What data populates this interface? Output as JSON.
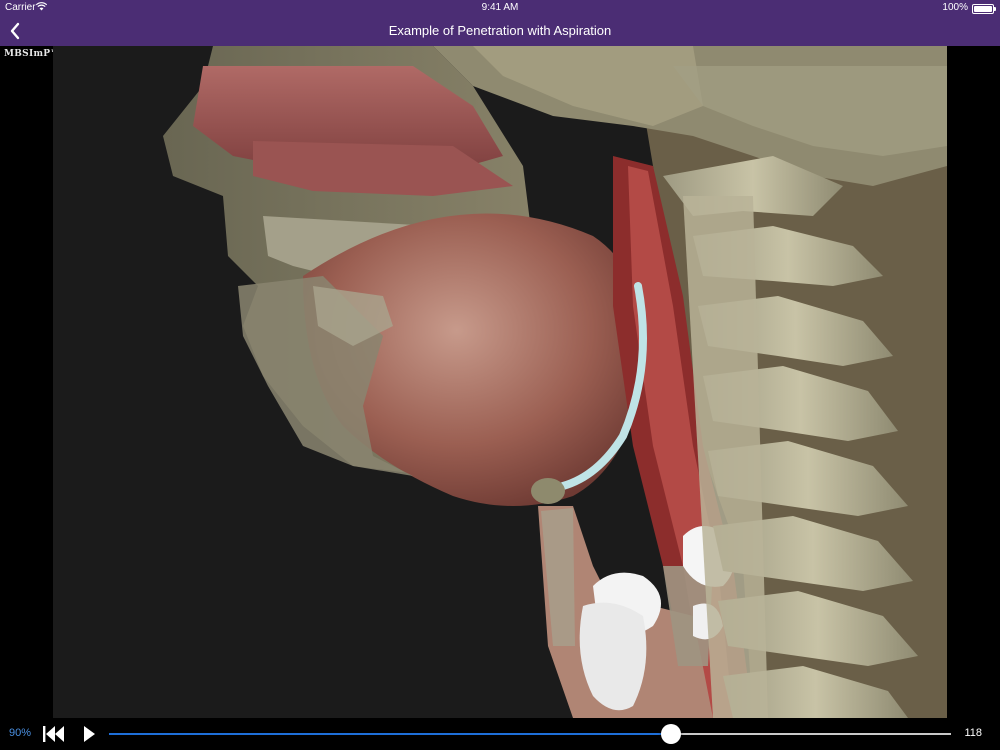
{
  "status_bar": {
    "carrier": "Carrier",
    "time": "9:41 AM",
    "battery": "100%"
  },
  "nav": {
    "title": "Example of Penetration with Aspiration",
    "back_icon": "chevron-left-icon"
  },
  "video": {
    "logo": "MBSImP™",
    "description_icons": [
      "skull",
      "vertebrae",
      "tongue",
      "larynx",
      "bolus"
    ]
  },
  "controls": {
    "speed": "90%",
    "restart_icon": "skip-to-start-icon",
    "play_icon": "play-icon",
    "total": "118",
    "progress": 0.667
  },
  "colors": {
    "nav_bg": "#4b2d74",
    "progress": "#1e6fd9",
    "speed_text": "#4a90e2"
  }
}
